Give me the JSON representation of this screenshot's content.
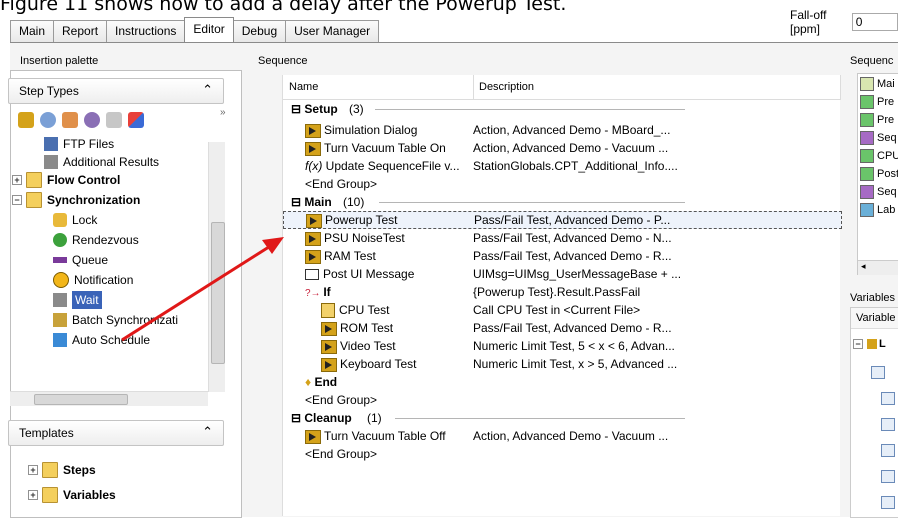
{
  "caption": "Figure 11 shows how to add a delay after the Powerup Test.",
  "tabs": [
    "Main",
    "Report",
    "Instructions",
    "Editor",
    "Debug",
    "User Manager"
  ],
  "active_tab": "Editor",
  "falloff": {
    "label": "Fall-off [ppm]",
    "value": "0"
  },
  "palette": {
    "title": "Insertion palette",
    "step_types_label": "Step Types",
    "more": "»",
    "items": [
      "FTP Files",
      "Additional Results",
      "Flow Control",
      "Synchronization",
      "Lock",
      "Rendezvous",
      "Queue",
      "Notification",
      "Wait",
      "Batch Synchronizati",
      "Auto Schedule"
    ],
    "templates_label": "Templates",
    "template_items": [
      "Steps",
      "Variables"
    ]
  },
  "sequence": {
    "title": "Sequence",
    "col_name": "Name",
    "col_desc": "Description",
    "setup": {
      "label": "Setup",
      "count": "(3)"
    },
    "setup_rows": [
      {
        "name": "Simulation Dialog",
        "desc": "Action,  Advanced Demo - MBoard_..."
      },
      {
        "name": "Turn Vacuum Table On",
        "desc": "Action,  Advanced Demo - Vacuum ..."
      },
      {
        "name": "Update SequenceFile v...",
        "desc": "StationGlobals.CPT_Additional_Info...."
      }
    ],
    "end_group": "<End Group>",
    "main": {
      "label": "Main",
      "count": "(10)"
    },
    "main_rows": [
      {
        "name": "Powerup Test",
        "desc": "Pass/Fail Test,  Advanced Demo - P..."
      },
      {
        "name": "PSU NoiseTest",
        "desc": "Pass/Fail Test,  Advanced Demo - N..."
      },
      {
        "name": "RAM Test",
        "desc": "Pass/Fail Test,  Advanced Demo - R..."
      },
      {
        "name": "Post UI Message",
        "desc": "UIMsg=UIMsg_UserMessageBase + ..."
      },
      {
        "name": "If",
        "desc": "{Powerup Test}.Result.PassFail"
      },
      {
        "name": "CPU Test",
        "desc": "Call CPU Test in <Current File>"
      },
      {
        "name": "ROM Test",
        "desc": "Pass/Fail Test,  Advanced Demo - R..."
      },
      {
        "name": "Video Test",
        "desc": "Numeric Limit Test,  5 < x < 6, Advan..."
      },
      {
        "name": "Keyboard Test",
        "desc": "Numeric Limit Test,  x > 5, Advanced ..."
      },
      {
        "name": "End",
        "desc": ""
      }
    ],
    "cleanup": {
      "label": "Cleanup",
      "count": "(1)"
    },
    "cleanup_rows": [
      {
        "name": "Turn Vacuum Table Off",
        "desc": "Action,  Advanced Demo - Vacuum ..."
      }
    ]
  },
  "right": {
    "sequences_title": "Sequenc",
    "seq_items": [
      "Mai",
      "Pre",
      "Pre",
      "Seq",
      "CPU",
      "Post",
      "Seq",
      "Lab"
    ],
    "variables_title": "Variables",
    "variables_header": "Variable",
    "var_root": "L"
  },
  "colors": {
    "step_icon": "#d4a21a",
    "arrow": "#e01818",
    "wait_select": "#3a63b8"
  }
}
